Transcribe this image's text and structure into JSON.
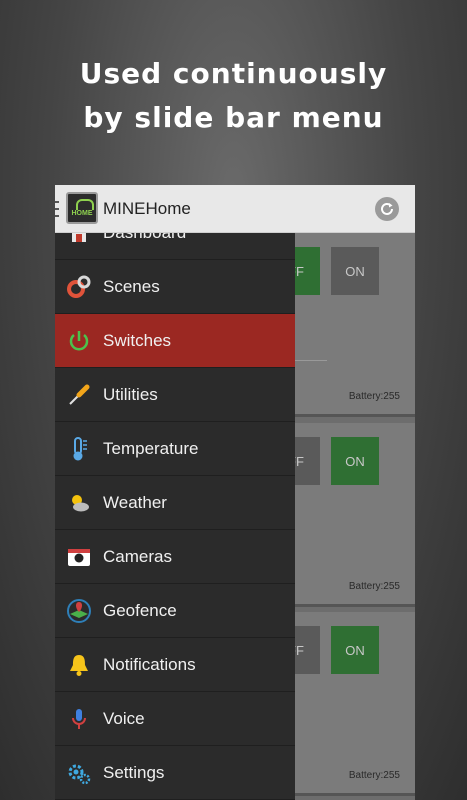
{
  "headline": {
    "line1": "Used continuously",
    "line2": "by slide bar menu"
  },
  "app": {
    "title": "MINEHome",
    "logo_text": "HOME"
  },
  "drawer": {
    "items": [
      {
        "label": "Dashboard",
        "icon": "home-icon"
      },
      {
        "label": "Scenes",
        "icon": "scenes-icon"
      },
      {
        "label": "Switches",
        "icon": "power-icon",
        "selected": true
      },
      {
        "label": "Utilities",
        "icon": "screwdriver-icon"
      },
      {
        "label": "Temperature",
        "icon": "thermometer-icon"
      },
      {
        "label": "Weather",
        "icon": "weather-icon"
      },
      {
        "label": "Cameras",
        "icon": "camera-icon"
      },
      {
        "label": "Geofence",
        "icon": "geofence-icon"
      },
      {
        "label": "Notifications",
        "icon": "bell-icon"
      },
      {
        "label": "Voice",
        "icon": "microphone-icon"
      },
      {
        "label": "Settings",
        "icon": "gear-icon"
      }
    ]
  },
  "cards": [
    {
      "off_label": "FF",
      "on_label": "ON",
      "battery": "Battery:255",
      "state": "off"
    },
    {
      "off_label": "FF",
      "on_label": "ON",
      "battery": "Battery:255",
      "state": "on"
    },
    {
      "off_label": "FF",
      "on_label": "ON",
      "battery": "Battery:255",
      "state": "on"
    }
  ],
  "colors": {
    "drawer_bg": "#2b2b2b",
    "selected_item": "#9b2822",
    "switch_active": "#2f6f33",
    "action_bar": "#e8e8e8"
  }
}
